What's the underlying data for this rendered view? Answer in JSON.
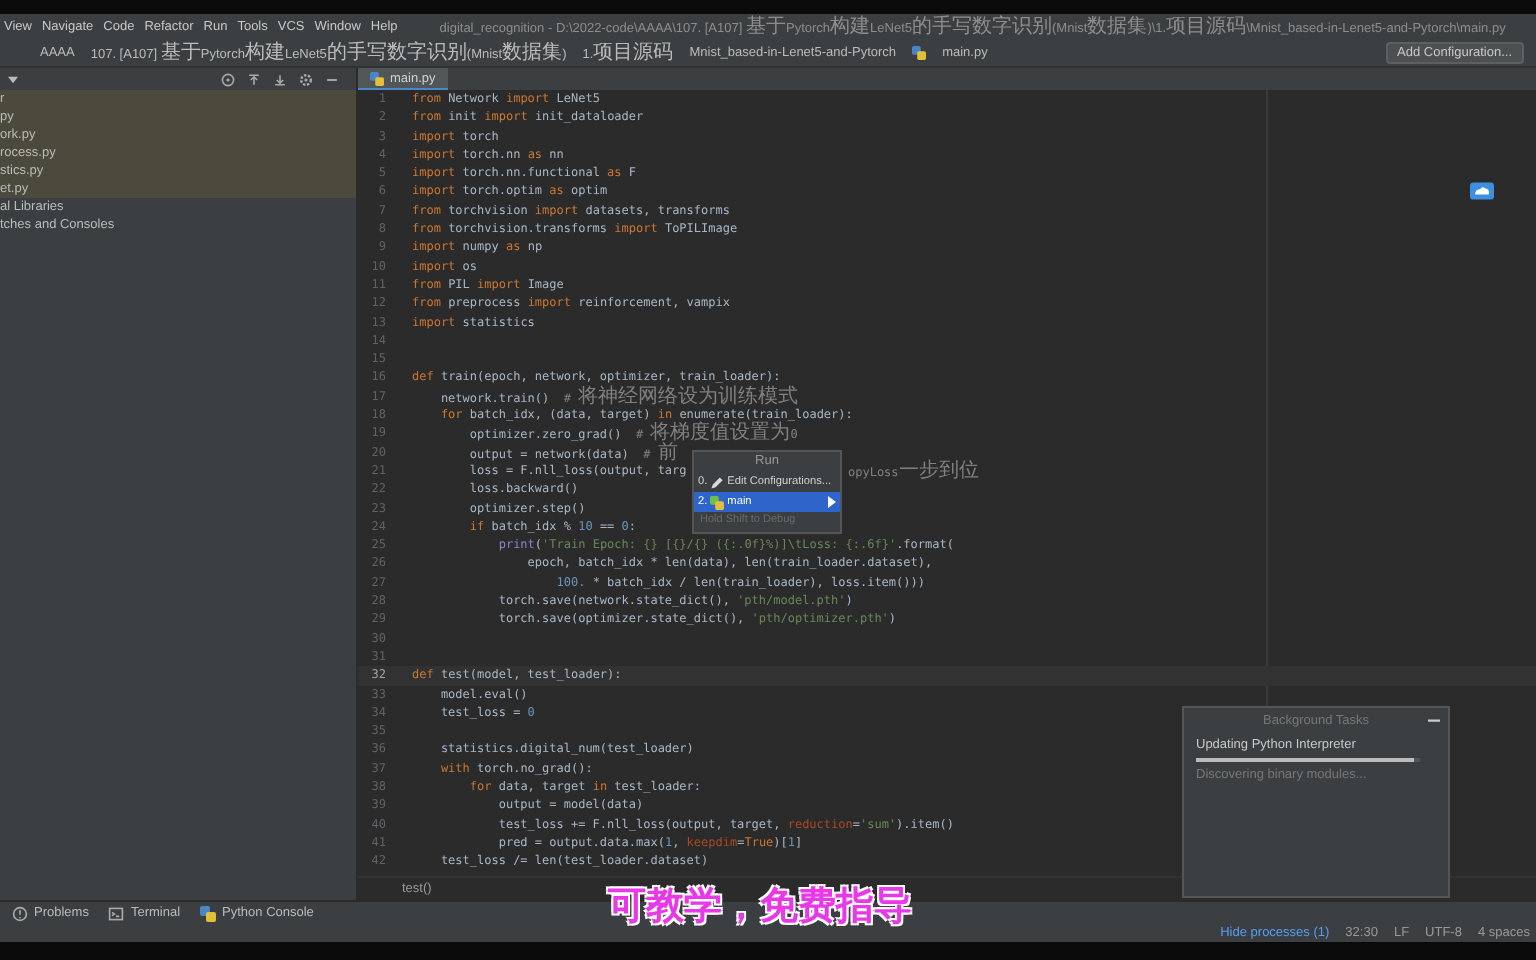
{
  "menu_bar": {
    "items": [
      "View",
      "Navigate",
      "Code",
      "Refactor",
      "Run",
      "Tools",
      "VCS",
      "Window",
      "Help"
    ],
    "title": "digital_recognition - D:\\2022-code\\AAAA\\107. [A107] 基于Pytorch构建LeNet5的手写数字识别(Mnist数据集)\\1.项目源码\\Mnist_based-in-Lenet5-and-Pytorch\\main.py"
  },
  "breadcrumbs": {
    "items": [
      "AAAA",
      "107. [A107] 基于Pytorch构建LeNet5的手写数字识别(Mnist数据集)",
      "1.项目源码",
      "Mnist_based-in-Lenet5-and-Pytorch",
      "main.py"
    ],
    "run_config_button": "Add Configuration..."
  },
  "project_panel": {
    "items": [
      {
        "label": "r",
        "selected": true
      },
      {
        "label": "py",
        "selected": true
      },
      {
        "label": "ork.py",
        "selected": true
      },
      {
        "label": "rocess.py",
        "selected": true
      },
      {
        "label": "stics.py",
        "selected": true
      },
      {
        "label": "et.py",
        "selected": true
      },
      {
        "label": "al Libraries",
        "selected": false
      },
      {
        "label": "tches and Consoles",
        "selected": false
      }
    ]
  },
  "editor": {
    "tabs": [
      {
        "label": "main.py",
        "selected": true
      }
    ],
    "lines": [
      {
        "number": "1",
        "current": false,
        "tokens": [
          {
            "kind": "keyword",
            "text": "from"
          },
          {
            "kind": "plain",
            "text": " Network "
          },
          {
            "kind": "keyword",
            "text": "import"
          },
          {
            "kind": "plain",
            "text": " LeNet5"
          }
        ]
      },
      {
        "number": "2",
        "current": false,
        "tokens": [
          {
            "kind": "keyword",
            "text": "from"
          },
          {
            "kind": "plain",
            "text": " init "
          },
          {
            "kind": "keyword",
            "text": "import"
          },
          {
            "kind": "plain",
            "text": " init_dataloader"
          }
        ]
      },
      {
        "number": "3",
        "current": false,
        "tokens": [
          {
            "kind": "keyword",
            "text": "import"
          },
          {
            "kind": "plain",
            "text": " torch"
          }
        ]
      },
      {
        "number": "4",
        "current": false,
        "tokens": [
          {
            "kind": "keyword",
            "text": "import"
          },
          {
            "kind": "plain",
            "text": " torch.nn "
          },
          {
            "kind": "keyword",
            "text": "as"
          },
          {
            "kind": "plain",
            "text": " nn"
          }
        ]
      },
      {
        "number": "5",
        "current": false,
        "tokens": [
          {
            "kind": "keyword",
            "text": "import"
          },
          {
            "kind": "plain",
            "text": " torch.nn.functional "
          },
          {
            "kind": "keyword",
            "text": "as"
          },
          {
            "kind": "plain",
            "text": " F"
          }
        ]
      },
      {
        "number": "6",
        "current": false,
        "tokens": [
          {
            "kind": "keyword",
            "text": "import"
          },
          {
            "kind": "plain",
            "text": " torch.optim "
          },
          {
            "kind": "keyword",
            "text": "as"
          },
          {
            "kind": "plain",
            "text": " optim"
          }
        ]
      },
      {
        "number": "7",
        "current": false,
        "tokens": [
          {
            "kind": "keyword",
            "text": "from"
          },
          {
            "kind": "plain",
            "text": " torchvision "
          },
          {
            "kind": "keyword",
            "text": "import"
          },
          {
            "kind": "plain",
            "text": " datasets, transforms"
          }
        ]
      },
      {
        "number": "8",
        "current": false,
        "tokens": [
          {
            "kind": "keyword",
            "text": "from"
          },
          {
            "kind": "plain",
            "text": " torchvision.transforms "
          },
          {
            "kind": "keyword",
            "text": "import"
          },
          {
            "kind": "plain",
            "text": " ToPILImage"
          }
        ]
      },
      {
        "number": "9",
        "current": false,
        "tokens": [
          {
            "kind": "keyword",
            "text": "import"
          },
          {
            "kind": "plain",
            "text": " numpy "
          },
          {
            "kind": "keyword",
            "text": "as"
          },
          {
            "kind": "plain",
            "text": " np"
          }
        ]
      },
      {
        "number": "10",
        "current": false,
        "tokens": [
          {
            "kind": "keyword",
            "text": "import"
          },
          {
            "kind": "plain",
            "text": " os"
          }
        ]
      },
      {
        "number": "11",
        "current": false,
        "tokens": [
          {
            "kind": "keyword",
            "text": "from"
          },
          {
            "kind": "plain",
            "text": " PIL "
          },
          {
            "kind": "keyword",
            "text": "import"
          },
          {
            "kind": "plain",
            "text": " Image"
          }
        ]
      },
      {
        "number": "12",
        "current": false,
        "tokens": [
          {
            "kind": "keyword",
            "text": "from"
          },
          {
            "kind": "plain",
            "text": " preprocess "
          },
          {
            "kind": "keyword",
            "text": "import"
          },
          {
            "kind": "plain",
            "text": " reinforcement, vampix"
          }
        ]
      },
      {
        "number": "13",
        "current": false,
        "tokens": [
          {
            "kind": "keyword",
            "text": "import"
          },
          {
            "kind": "plain",
            "text": " statistics"
          }
        ]
      },
      {
        "number": "14",
        "current": false
      },
      {
        "number": "15",
        "current": false
      },
      {
        "number": "16",
        "current": false,
        "tokens": [
          {
            "kind": "keyword",
            "text": "def"
          },
          {
            "kind": "plain",
            "text": " train(epoch, network, optimizer, train_loader):"
          }
        ]
      },
      {
        "number": "17",
        "current": false,
        "tokens": [
          {
            "kind": "plain",
            "text": "    network.train()  "
          },
          {
            "kind": "comment",
            "text": "# 将神经网络设为训练模式"
          }
        ]
      },
      {
        "number": "18",
        "current": false,
        "tokens": [
          {
            "kind": "keyword",
            "text": "    for"
          },
          {
            "kind": "plain",
            "text": " batch_idx, (data, target) "
          },
          {
            "kind": "keyword",
            "text": "in"
          },
          {
            "kind": "plain",
            "text": " enumerate(train_loader):"
          }
        ]
      },
      {
        "number": "19",
        "current": false,
        "tokens": [
          {
            "kind": "plain",
            "text": "        optimizer.zero_grad()  "
          },
          {
            "kind": "comment",
            "text": "# 将梯度值设置为0"
          }
        ]
      },
      {
        "number": "20",
        "current": false,
        "tokens": [
          {
            "kind": "plain",
            "text": "        output = network(data)  "
          },
          {
            "kind": "comment",
            "text": "# 前"
          }
        ]
      },
      {
        "number": "21",
        "current": false,
        "tokens": [
          {
            "kind": "plain",
            "text": "        loss = F.nll_loss(output, targ"
          }
        ],
        "after_menu": [
          {
            "kind": "comment",
            "text": "opyLoss一步到位"
          }
        ]
      },
      {
        "number": "22",
        "current": false,
        "tokens": [
          {
            "kind": "plain",
            "text": "        loss.backward()"
          }
        ]
      },
      {
        "number": "23",
        "current": false,
        "tokens": [
          {
            "kind": "plain",
            "text": "        optimizer.step()"
          }
        ]
      },
      {
        "number": "24",
        "current": false,
        "tokens": [
          {
            "kind": "keyword",
            "text": "        if"
          },
          {
            "kind": "plain",
            "text": " batch_idx % "
          },
          {
            "kind": "number",
            "text": "10"
          },
          {
            "kind": "plain",
            "text": " == "
          },
          {
            "kind": "number",
            "text": "0"
          },
          {
            "kind": "plain",
            "text": ":"
          }
        ]
      },
      {
        "number": "25",
        "current": false,
        "tokens": [
          {
            "kind": "builtin",
            "text": "            print"
          },
          {
            "kind": "plain",
            "text": "("
          },
          {
            "kind": "string",
            "text": "'Train Epoch: {} [{}/{} ({:.0f}%)]\\tLoss: {:.6f}'"
          },
          {
            "kind": "plain",
            "text": ".format("
          }
        ]
      },
      {
        "number": "26",
        "current": false,
        "tokens": [
          {
            "kind": "plain",
            "text": "                epoch, batch_idx * len(data), len(train_loader.dataset),"
          }
        ]
      },
      {
        "number": "27",
        "current": false,
        "tokens": [
          {
            "kind": "number",
            "text": "                    100."
          },
          {
            "kind": "plain",
            "text": " * batch_idx / len(train_loader), loss.item()))"
          }
        ]
      },
      {
        "number": "28",
        "current": false,
        "tokens": [
          {
            "kind": "plain",
            "text": "            torch.save(network.state_dict(), "
          },
          {
            "kind": "string",
            "text": "'pth/model.pth'"
          },
          {
            "kind": "plain",
            "text": ")"
          }
        ]
      },
      {
        "number": "29",
        "current": false,
        "tokens": [
          {
            "kind": "plain",
            "text": "            torch.save(optimizer.state_dict(), "
          },
          {
            "kind": "string",
            "text": "'pth/optimizer.pth'"
          },
          {
            "kind": "plain",
            "text": ")"
          }
        ]
      },
      {
        "number": "30",
        "current": false
      },
      {
        "number": "31",
        "current": false
      },
      {
        "number": "32",
        "current": true,
        "tokens": [
          {
            "kind": "keyword",
            "text": "def"
          },
          {
            "kind": "plain",
            "text": " test(model, test_loader):"
          }
        ]
      },
      {
        "number": "33",
        "current": false,
        "tokens": [
          {
            "kind": "plain",
            "text": "    model.eval()"
          }
        ]
      },
      {
        "number": "34",
        "current": false,
        "tokens": [
          {
            "kind": "plain",
            "text": "    test_loss = "
          },
          {
            "kind": "number",
            "text": "0"
          }
        ]
      },
      {
        "number": "35",
        "current": false
      },
      {
        "number": "36",
        "current": false,
        "tokens": [
          {
            "kind": "plain",
            "text": "    statistics.digital_num(test_loader)"
          }
        ]
      },
      {
        "number": "37",
        "current": false,
        "tokens": [
          {
            "kind": "keyword",
            "text": "    with"
          },
          {
            "kind": "plain",
            "text": " torch.no_grad():"
          }
        ]
      },
      {
        "number": "38",
        "current": false,
        "tokens": [
          {
            "kind": "keyword",
            "text": "        for"
          },
          {
            "kind": "plain",
            "text": " data, target "
          },
          {
            "kind": "keyword",
            "text": "in"
          },
          {
            "kind": "plain",
            "text": " test_loader:"
          }
        ]
      },
      {
        "number": "39",
        "current": false,
        "tokens": [
          {
            "kind": "plain",
            "text": "            output = model(data)"
          }
        ]
      },
      {
        "number": "40",
        "current": false,
        "tokens": [
          {
            "kind": "plain",
            "text": "            test_loss += F.nll_loss(output, target, "
          },
          {
            "kind": "param",
            "text": "reduction"
          },
          {
            "kind": "plain",
            "text": "="
          },
          {
            "kind": "string",
            "text": "'sum'"
          },
          {
            "kind": "plain",
            "text": ").item()"
          }
        ]
      },
      {
        "number": "41",
        "current": false,
        "tokens": [
          {
            "kind": "plain",
            "text": "            pred = output.data.max("
          },
          {
            "kind": "number",
            "text": "1"
          },
          {
            "kind": "plain",
            "text": ", "
          },
          {
            "kind": "param",
            "text": "keepdim"
          },
          {
            "kind": "plain",
            "text": "="
          },
          {
            "kind": "keyword",
            "text": "True"
          },
          {
            "kind": "plain",
            "text": ")["
          },
          {
            "kind": "number",
            "text": "1"
          },
          {
            "kind": "plain",
            "text": "]"
          }
        ]
      },
      {
        "number": "42",
        "current": false,
        "tokens": [
          {
            "kind": "plain",
            "text": "    test_loss /= len(test_loader.dataset)"
          }
        ]
      }
    ],
    "breadcrumb": "test()"
  },
  "run_popup": {
    "title": "Run",
    "items": [
      {
        "number": "0.",
        "label": "Edit Configurations...",
        "kind": "edit",
        "selected": false,
        "submenu": false
      },
      {
        "number": "2.",
        "label": "main",
        "kind": "run",
        "selected": true,
        "submenu": true
      }
    ],
    "hint": "Hold Shift to Debug"
  },
  "background_tasks": {
    "title": "Background Tasks",
    "task": "Updating Python Interpreter",
    "level": 0.97,
    "detail": "Discovering binary modules..."
  },
  "tool_tabs": [
    {
      "label": "Problems",
      "kind": "problems"
    },
    {
      "label": "Terminal",
      "kind": "terminal"
    },
    {
      "label": "Python Console",
      "kind": "console"
    }
  ],
  "status_bar": {
    "processes_link": "Hide processes (1)",
    "items": [
      "32:30",
      "LF",
      "UTF-8",
      "4 spaces"
    ]
  },
  "caption": "可教学，免费指导"
}
